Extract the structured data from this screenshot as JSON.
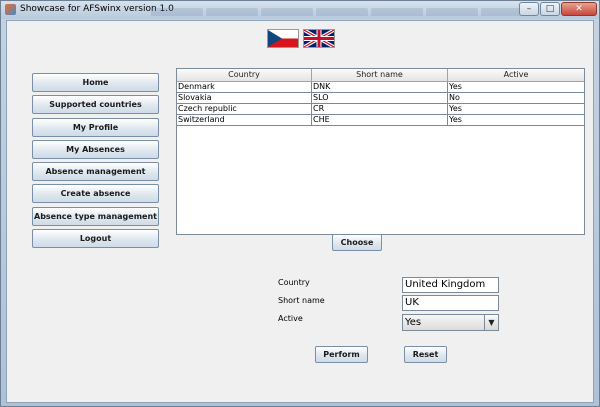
{
  "window": {
    "title": "Showcase for AFSwinx version 1.0",
    "minimize": "–",
    "maximize": "□",
    "close": "✕"
  },
  "menu": {
    "items": [
      {
        "label": "Home"
      },
      {
        "label": "Supported countries"
      },
      {
        "label": "My Profile"
      },
      {
        "label": "My Absences"
      },
      {
        "label": "Absence management"
      },
      {
        "label": "Create absence"
      },
      {
        "label": "Absence type management"
      },
      {
        "label": "Logout"
      }
    ]
  },
  "table": {
    "columns": [
      "Country",
      "Short name",
      "Active"
    ],
    "rows": [
      [
        "Denmark",
        "DNK",
        "Yes"
      ],
      [
        "Slovakia",
        "SLO",
        "No"
      ],
      [
        "Czech republic",
        "CR",
        "Yes"
      ],
      [
        "Switzerland",
        "CHE",
        "Yes"
      ]
    ]
  },
  "choose_label": "Choose",
  "form": {
    "country_label": "Country",
    "country_value": "United Kingdom",
    "short_name_label": "Short name",
    "short_name_value": "UK",
    "active_label": "Active",
    "active_value": "Yes"
  },
  "actions": {
    "perform_label": "Perform",
    "reset_label": "Reset"
  },
  "icons": {
    "flag_cz": "czech-flag-icon",
    "flag_uk": "uk-flag-icon",
    "dropdown": "chevron-down-icon"
  }
}
